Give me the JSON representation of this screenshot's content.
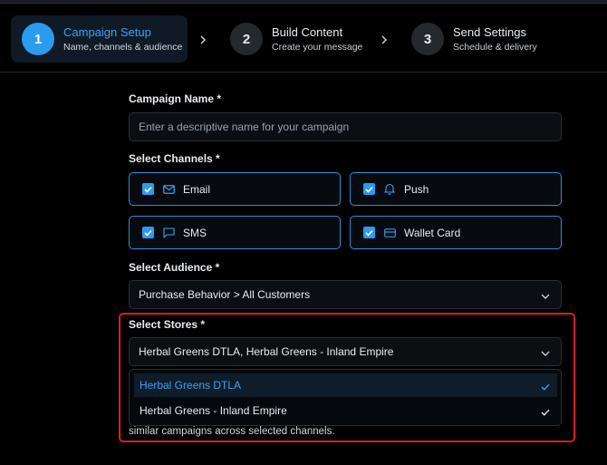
{
  "stepper": {
    "steps": [
      {
        "number": "1",
        "title": "Campaign Setup",
        "subtitle": "Name, channels & audience"
      },
      {
        "number": "2",
        "title": "Build Content",
        "subtitle": "Create your message"
      },
      {
        "number": "3",
        "title": "Send Settings",
        "subtitle": "Schedule & delivery"
      }
    ]
  },
  "form": {
    "campaign_name": {
      "label": "Campaign Name *",
      "placeholder": "Enter a descriptive name for your campaign"
    },
    "channels": {
      "label": "Select Channels *",
      "items": [
        {
          "label": "Email",
          "icon": "mail-icon",
          "checked": true
        },
        {
          "label": "Push",
          "icon": "bell-icon",
          "checked": true
        },
        {
          "label": "SMS",
          "icon": "chat-icon",
          "checked": true
        },
        {
          "label": "Wallet Card",
          "icon": "card-icon",
          "checked": true
        }
      ]
    },
    "audience": {
      "label": "Select Audience *",
      "value": "Purchase Behavior > All Customers"
    },
    "stores": {
      "label": "Select Stores *",
      "value": "Herbal Greens DTLA, Herbal Greens - Inland Empire",
      "options": [
        {
          "label": "Herbal Greens DTLA",
          "selected": true
        },
        {
          "label": "Herbal Greens - Inland Empire",
          "selected": true
        }
      ]
    },
    "note": "similar campaigns across selected channels."
  },
  "colors": {
    "accent": "#2b9bf0",
    "highlight": "#e01b24",
    "background": "#000000"
  }
}
